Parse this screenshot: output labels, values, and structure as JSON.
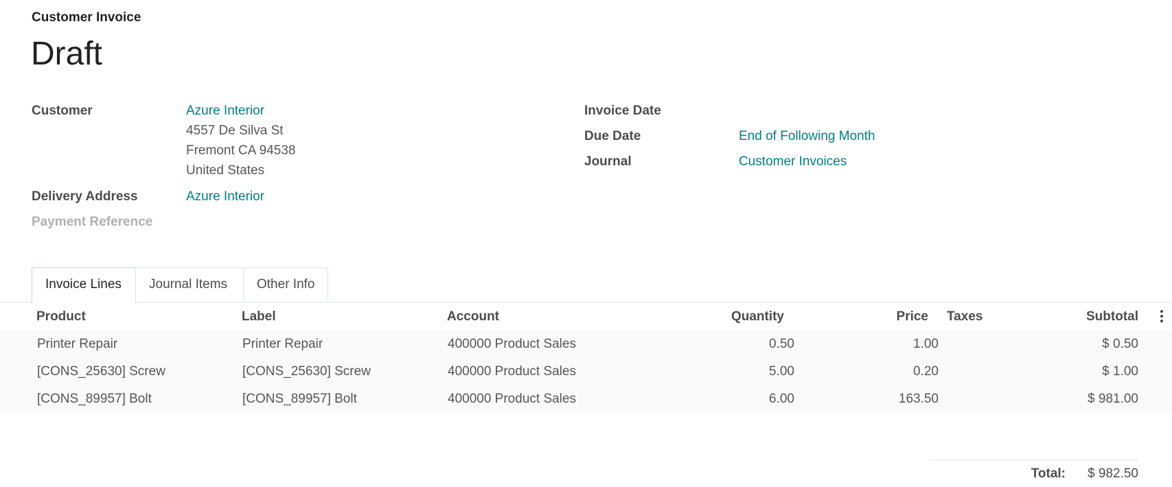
{
  "header": {
    "doc_type": "Customer Invoice",
    "state": "Draft"
  },
  "fields": {
    "customer_label": "Customer",
    "customer_name": "Azure Interior",
    "address": [
      "4557 De Silva St",
      "Fremont CA 94538",
      "United States"
    ],
    "delivery_label": "Delivery Address",
    "delivery_value": "Azure Interior",
    "payment_ref_label": "Payment Reference",
    "invoice_date_label": "Invoice Date",
    "due_date_label": "Due Date",
    "due_date_value": "End of Following Month",
    "journal_label": "Journal",
    "journal_value": "Customer Invoices"
  },
  "tabs": [
    {
      "label": "Invoice Lines",
      "active": true
    },
    {
      "label": "Journal Items",
      "active": false
    },
    {
      "label": "Other Info",
      "active": false
    }
  ],
  "table": {
    "columns": [
      "Product",
      "Label",
      "Account",
      "Quantity",
      "Price",
      "Taxes",
      "Subtotal"
    ],
    "rows": [
      [
        "Printer Repair",
        "Printer Repair",
        "400000 Product Sales",
        "0.50",
        "1.00",
        "",
        "$ 0.50"
      ],
      [
        "[CONS_25630] Screw",
        "[CONS_25630] Screw",
        "400000 Product Sales",
        "5.00",
        "0.20",
        "",
        "$ 1.00"
      ],
      [
        "[CONS_89957] Bolt",
        "[CONS_89957] Bolt",
        "400000 Product Sales",
        "6.00",
        "163.50",
        "",
        "$ 981.00"
      ]
    ]
  },
  "totals": {
    "label": "Total:",
    "value": "$ 982.50"
  },
  "colors": {
    "link": "#017e84",
    "text": "#4c4c4c",
    "muted": "#b0b0b0"
  }
}
